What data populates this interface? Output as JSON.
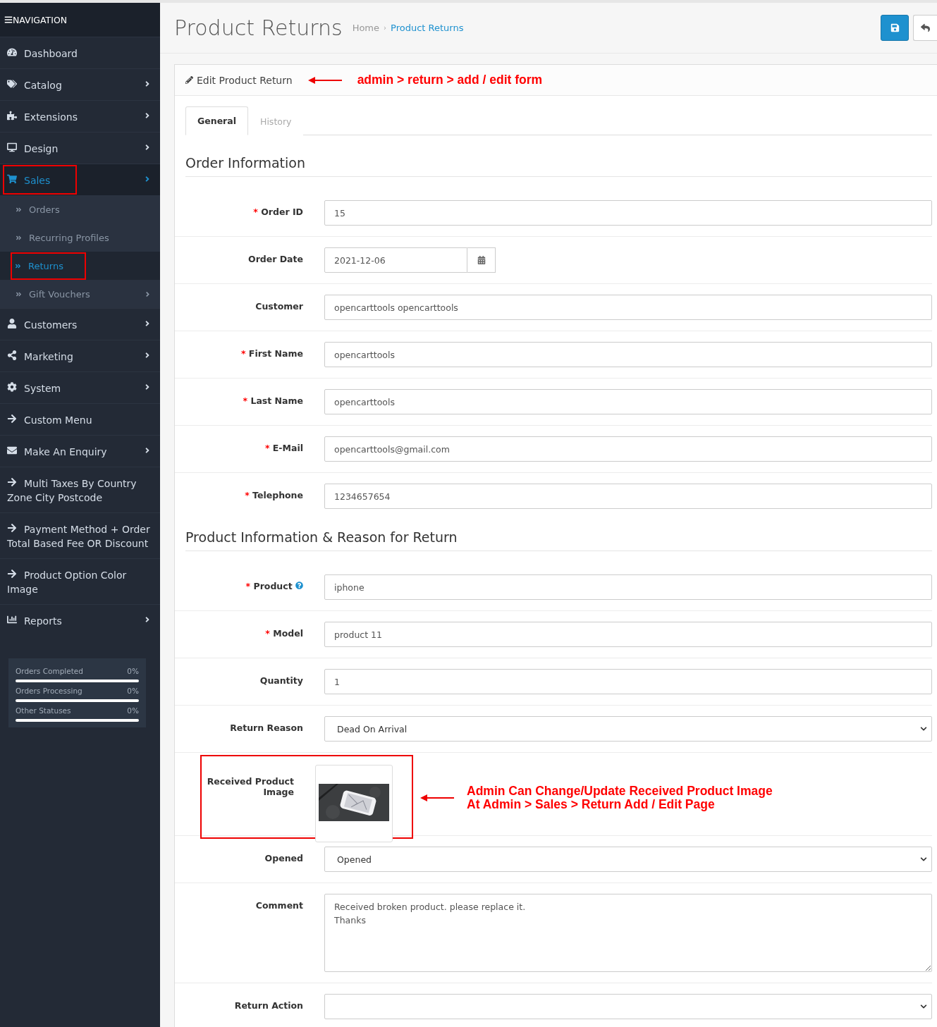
{
  "sidebar": {
    "title": "NAVIGATION",
    "items": [
      {
        "label": "Dashboard",
        "has_children": false,
        "selected": false,
        "highlighted": false
      },
      {
        "label": "Catalog",
        "has_children": true,
        "selected": false,
        "highlighted": false
      },
      {
        "label": "Extensions",
        "has_children": true,
        "selected": false,
        "highlighted": false
      },
      {
        "label": "Design",
        "has_children": true,
        "selected": false,
        "highlighted": false
      },
      {
        "label": "Sales",
        "has_children": true,
        "selected": true,
        "highlighted": true,
        "children": [
          {
            "label": "Orders",
            "has_children": false,
            "selected": false,
            "highlighted": false
          },
          {
            "label": "Recurring Profiles",
            "has_children": false,
            "selected": false,
            "highlighted": false
          },
          {
            "label": "Returns",
            "has_children": false,
            "selected": true,
            "highlighted": true
          },
          {
            "label": "Gift Vouchers",
            "has_children": true,
            "selected": false,
            "highlighted": false
          }
        ]
      },
      {
        "label": "Customers",
        "has_children": true,
        "selected": false,
        "highlighted": false
      },
      {
        "label": "Marketing",
        "has_children": true,
        "selected": false,
        "highlighted": false
      },
      {
        "label": "System",
        "has_children": true,
        "selected": false,
        "highlighted": false
      },
      {
        "label": "Custom Menu",
        "has_children": false,
        "selected": false,
        "highlighted": false
      },
      {
        "label": "Make An Enquiry",
        "has_children": true,
        "selected": false,
        "highlighted": false
      },
      {
        "label": "Multi Taxes By Country Zone City Postcode",
        "has_children": false,
        "selected": false,
        "highlighted": false
      },
      {
        "label": "Payment Method + Order Total Based Fee OR Discount",
        "has_children": false,
        "selected": false,
        "highlighted": false
      },
      {
        "label": "Product Option Color Image",
        "has_children": false,
        "selected": false,
        "highlighted": false
      },
      {
        "label": "Reports",
        "has_children": true,
        "selected": false,
        "highlighted": false
      }
    ],
    "stats": [
      {
        "label": "Orders Completed",
        "reading": "0%",
        "level": 0
      },
      {
        "label": "Orders Processing",
        "reading": "0%",
        "level": 0
      },
      {
        "label": "Other Statuses",
        "reading": "0%",
        "level": 0
      }
    ]
  },
  "page": {
    "title": "Product Returns",
    "breadcrumbs": [
      "Home",
      "Product Returns"
    ],
    "breadcrumb_separator": "›"
  },
  "panel": {
    "title": "Edit Product Return",
    "annotation": "admin > return > add / edit form",
    "tabs": [
      {
        "label": "General",
        "selected": true
      },
      {
        "label": "History",
        "selected": false
      }
    ],
    "sections": [
      {
        "title": "Order Information",
        "fields": [
          {
            "kind": "text",
            "required_mark": "*",
            "label": "Order ID",
            "value": "15"
          },
          {
            "kind": "date",
            "label": "Order Date",
            "value": "2021-12-06"
          },
          {
            "kind": "text",
            "label": "Customer",
            "value": "opencarttools opencarttools"
          },
          {
            "kind": "text",
            "required_mark": "*",
            "label": "First Name",
            "value": "opencarttools"
          },
          {
            "kind": "text",
            "required_mark": "*",
            "label": "Last Name",
            "value": "opencarttools"
          },
          {
            "kind": "text",
            "required_mark": "*",
            "label": "E-Mail",
            "value": "opencarttools@gmail.com"
          },
          {
            "kind": "text",
            "required_mark": "*",
            "label": "Telephone",
            "value": "1234657654"
          }
        ]
      },
      {
        "title": "Product Information & Reason for Return",
        "fields": [
          {
            "kind": "text",
            "required_mark": "*",
            "label": "Product",
            "help": true,
            "value": "iphone"
          },
          {
            "kind": "text",
            "required_mark": "*",
            "label": "Model",
            "value": "product 11"
          },
          {
            "kind": "text",
            "label": "Quantity",
            "value": "1"
          },
          {
            "kind": "select",
            "label": "Return Reason",
            "value": "Dead On Arrival"
          },
          {
            "label": "Received Product Image",
            "highlighted": true,
            "annotation": [
              "Admin Can Change/Update Received Product Image",
              "At Admin > Sales > Return Add / Edit Page"
            ]
          },
          {
            "kind": "select",
            "label": "Opened",
            "value": "Opened"
          },
          {
            "kind": "textarea",
            "label": "Comment",
            "value": "Received broken product. please replace it.\nThanks"
          },
          {
            "kind": "select",
            "label": "Return Action"
          }
        ]
      }
    ]
  }
}
